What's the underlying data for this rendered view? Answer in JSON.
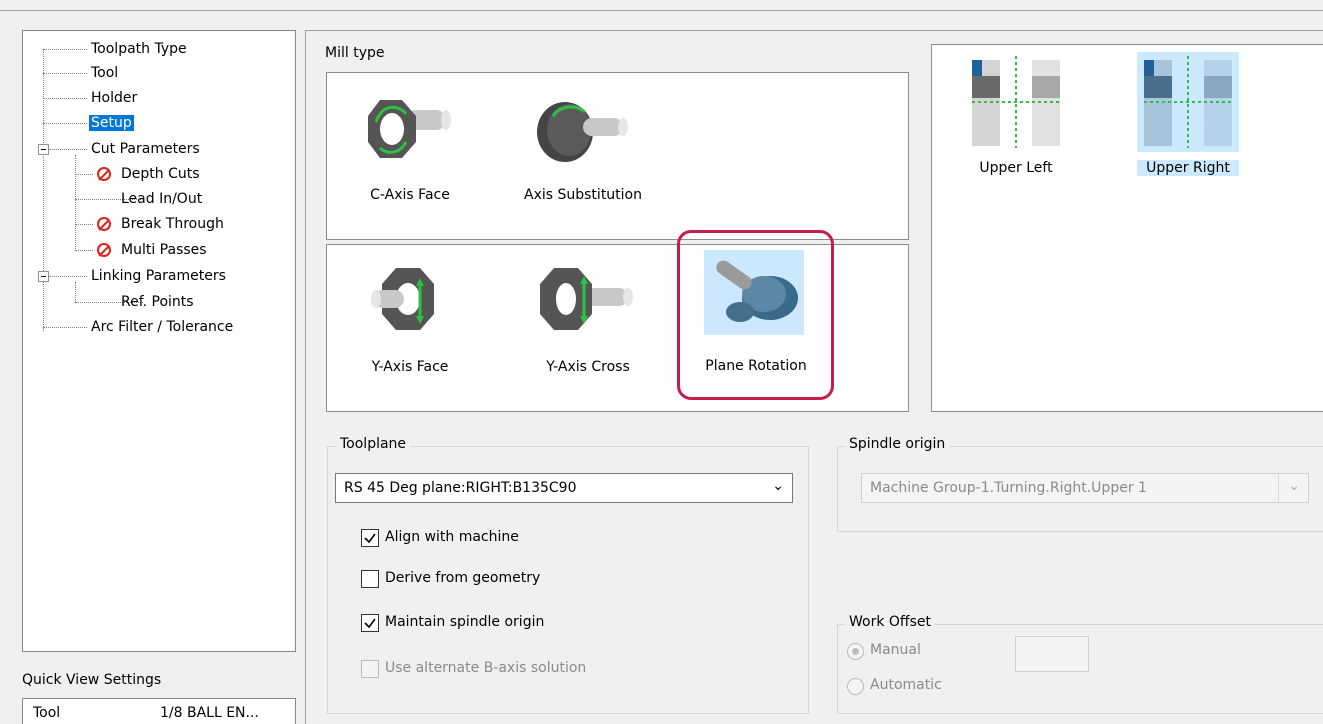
{
  "tree": {
    "items": [
      {
        "label": "Toolpath Type"
      },
      {
        "label": "Tool"
      },
      {
        "label": "Holder"
      },
      {
        "label": "Setup"
      },
      {
        "label": "Cut Parameters"
      },
      {
        "label": "Depth Cuts"
      },
      {
        "label": "Lead In/Out"
      },
      {
        "label": "Break Through"
      },
      {
        "label": "Multi Passes"
      },
      {
        "label": "Linking Parameters"
      },
      {
        "label": "Ref. Points"
      },
      {
        "label": "Arc Filter / Tolerance"
      }
    ]
  },
  "quick_view": {
    "title": "Quick View Settings",
    "rows": [
      {
        "label": "Tool",
        "value": "1/8 BALL EN..."
      }
    ]
  },
  "mill_type": {
    "title": "Mill type",
    "options": [
      {
        "label": "C-Axis Face"
      },
      {
        "label": "Axis Substitution"
      },
      {
        "label": "Y-Axis Face"
      },
      {
        "label": "Y-Axis Cross"
      },
      {
        "label": "Plane Rotation",
        "selected": true
      }
    ]
  },
  "spindle_images": [
    {
      "label": "Upper Left"
    },
    {
      "label": "Upper Right",
      "selected": true
    }
  ],
  "toolplane": {
    "title": "Toolplane",
    "value": "RS 45 Deg plane:RIGHT:B135C90",
    "checks": [
      {
        "label": "Align with machine",
        "checked": true,
        "enabled": true
      },
      {
        "label": "Derive from geometry",
        "checked": false,
        "enabled": true
      },
      {
        "label": "Maintain spindle origin",
        "checked": true,
        "enabled": true
      },
      {
        "label": "Use alternate B-axis solution",
        "checked": false,
        "enabled": false
      }
    ]
  },
  "spindle_origin": {
    "title": "Spindle origin",
    "value": "Machine Group-1.Turning.Right.Upper 1"
  },
  "work_offset": {
    "title": "Work Offset",
    "manual": "Manual",
    "automatic": "Automatic"
  },
  "colors": {
    "selection": "#0078d7",
    "selected_bg": "#cce8ff",
    "highlight_border": "#c41e4a",
    "disabled_text": "#8a8a8a"
  }
}
